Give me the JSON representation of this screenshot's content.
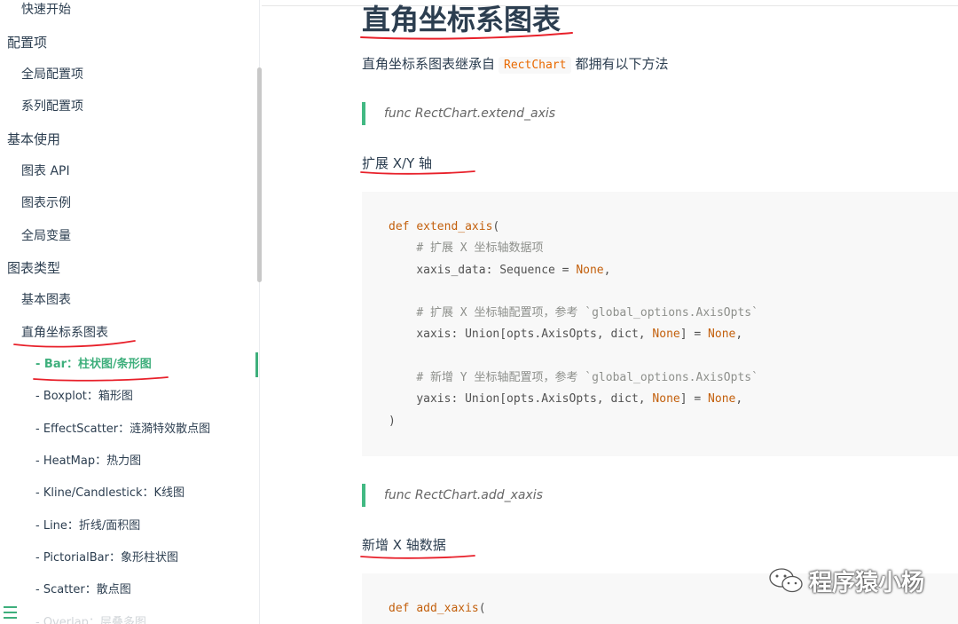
{
  "sidebar": {
    "items": [
      {
        "label": "快速开始",
        "level": "sub"
      },
      {
        "label": "配置项",
        "level": "section"
      },
      {
        "label": "全局配置项",
        "level": "sub"
      },
      {
        "label": "系列配置项",
        "level": "sub"
      },
      {
        "label": "基本使用",
        "level": "section"
      },
      {
        "label": "图表 API",
        "level": "sub"
      },
      {
        "label": "图表示例",
        "level": "sub"
      },
      {
        "label": "全局变量",
        "level": "sub"
      },
      {
        "label": "图表类型",
        "level": "section"
      },
      {
        "label": "基本图表",
        "level": "sub"
      },
      {
        "label": "直角坐标系图表",
        "level": "sub"
      },
      {
        "label": "- Bar：柱状图/条形图",
        "level": "leaf",
        "active": true
      },
      {
        "label": "- Boxplot：箱形图",
        "level": "leaf"
      },
      {
        "label": "- EffectScatter：涟漪特效散点图",
        "level": "leaf"
      },
      {
        "label": "- HeatMap：热力图",
        "level": "leaf"
      },
      {
        "label": "- Kline/Candlestick：K线图",
        "level": "leaf"
      },
      {
        "label": "- Line：折线/面积图",
        "level": "leaf"
      },
      {
        "label": "- PictorialBar：象形柱状图",
        "level": "leaf"
      },
      {
        "label": "- Scatter：散点图",
        "level": "leaf"
      },
      {
        "label": "- Overlap：层叠多图",
        "level": "leaf"
      }
    ],
    "menu_icon": "hamburger-menu-icon"
  },
  "main": {
    "title": "直角坐标系图表",
    "intro_before": "直角坐标系图表继承自",
    "intro_code": "RectChart",
    "intro_after": "都拥有以下方法",
    "func1": "func RectChart.extend_axis",
    "heading1": "扩展 X/Y 轴",
    "code1": {
      "def": "def",
      "fn_name": "extend_axis",
      "open": "(",
      "c1": "# 扩展 X 坐标轴数据项",
      "l1a": "xaxis_data: Sequence = ",
      "l1b": "None",
      "l1c": ",",
      "c2": "# 扩展 X 坐标轴配置项，参考 `global_options.AxisOpts`",
      "l2a": "xaxis: Union[opts.AxisOpts, dict, ",
      "l2b": "None",
      "l2c": "] = ",
      "l2d": "None",
      "l2e": ",",
      "c3": "# 新增 Y 坐标轴配置项，参考 `global_options.AxisOpts`",
      "l3a": "yaxis: Union[opts.AxisOpts, dict, ",
      "l3b": "None",
      "l3c": "] = ",
      "l3d": "None",
      "l3e": ",",
      "close": ")"
    },
    "func2": "func RectChart.add_xaxis",
    "heading2": "新增 X 轴数据",
    "code2": {
      "def": "def",
      "fn_name": "add_xaxis",
      "open": "("
    }
  },
  "watermark": "程序猿小杨",
  "colors": {
    "accent": "#3eaf7c",
    "annotation": "#e8202a",
    "code_bg": "#f8f8f8",
    "code_keyword": "#c3600d"
  }
}
